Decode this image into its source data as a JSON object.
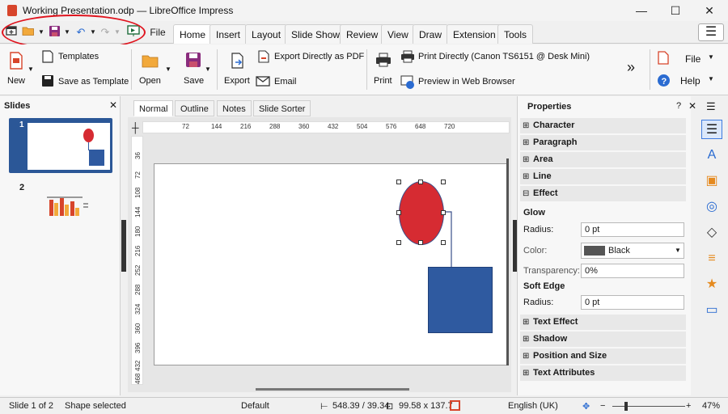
{
  "window": {
    "title": "Working Presentation.odp — LibreOffice Impress",
    "minimize": "—",
    "maximize": "☐",
    "close": "✕"
  },
  "quick_access": {
    "menu_partial": "File"
  },
  "tabs": [
    "Home",
    "Insert",
    "Layout",
    "Slide Show",
    "Review",
    "View",
    "Draw",
    "Extension",
    "Tools"
  ],
  "active_tab_index": 0,
  "hamburger": "☰",
  "ribbon": {
    "new": "New",
    "templates": "Templates",
    "save_as_template": "Save as Template",
    "open": "Open",
    "save": "Save",
    "export": "Export",
    "export_pdf": "Export Directly as PDF",
    "email": "Email",
    "print": "Print",
    "print_directly": "Print Directly (Canon TS6151 @ Desk Mini)",
    "preview_web": "Preview in Web Browser",
    "more": "»",
    "file_menu": "File",
    "help_menu": "Help"
  },
  "slides_pane": {
    "title": "Slides",
    "close": "✕",
    "slide_numbers": [
      "1",
      "2"
    ]
  },
  "view_tabs": [
    "Normal",
    "Outline",
    "Notes",
    "Slide Sorter"
  ],
  "active_view_index": 0,
  "ruler": {
    "h_ticks": [
      "72",
      "144",
      "216",
      "288",
      "360",
      "432",
      "504",
      "576",
      "648",
      "720"
    ],
    "v_ticks": [
      "36",
      "72",
      "108",
      "144",
      "180",
      "216",
      "252",
      "288",
      "324",
      "360",
      "396",
      "432",
      "468"
    ]
  },
  "properties": {
    "title": "Properties",
    "help": "?",
    "close": "✕",
    "menu": "☰",
    "sections_top": [
      "Character",
      "Paragraph",
      "Area",
      "Line",
      "Effect"
    ],
    "glow": {
      "heading": "Glow",
      "radius_label": "Radius:",
      "radius_value": "0 pt",
      "color_label": "Color:",
      "color_value": "Black",
      "transparency_label": "Transparency:",
      "transparency_value": "0%"
    },
    "soft_edge": {
      "heading": "Soft Edge",
      "radius_label": "Radius:",
      "radius_value": "0 pt"
    },
    "sections_bottom": [
      "Text Effect",
      "Shadow",
      "Position and Size",
      "Text Attributes"
    ]
  },
  "status": {
    "slide": "Slide 1 of 2",
    "selection": "Shape selected",
    "master": "Default",
    "position": "548.39 / 39.34",
    "size": "99.58 x 137.7",
    "language": "English (UK)",
    "zoom": "47%"
  },
  "colors": {
    "ellipse": "#d62b32",
    "rectangle": "#2f5aa0",
    "accent_red": "#e0141e"
  }
}
